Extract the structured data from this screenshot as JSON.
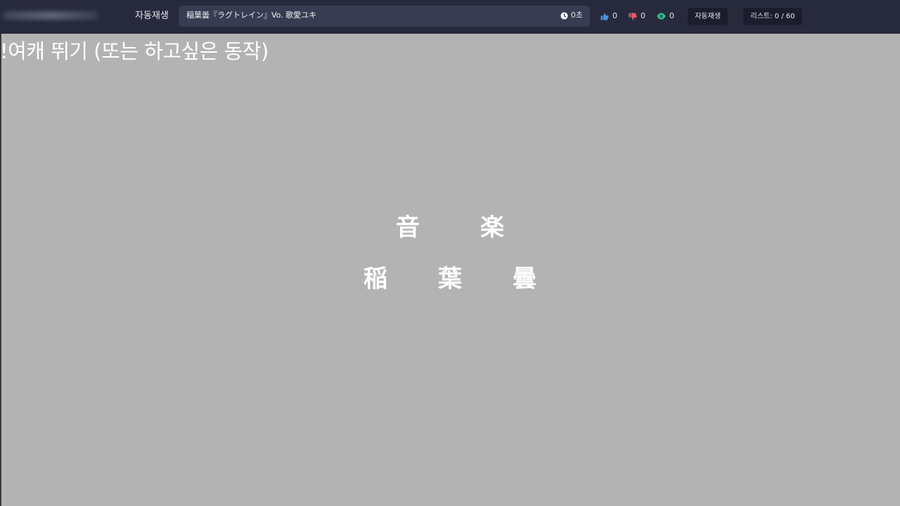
{
  "header": {
    "autoplay_label": "자동재생",
    "song": {
      "title": "稲葉曇『ラグトレイン』Vo. 歌愛ユキ",
      "duration": "0초"
    },
    "stats": {
      "likes": "0",
      "dislikes": "0",
      "views": "0"
    },
    "autoplay_button": "자동재생",
    "list_button": "리스트: 0 / 60"
  },
  "video": {
    "overlay_text": "!여캐 뛰기 (또는 하고싶은 동작)",
    "line1": "音楽",
    "line2": "稲葉曇"
  },
  "icons": {
    "clock": "clock-icon",
    "like": "thumbs-up-icon",
    "dislike": "thumbs-down-icon",
    "views": "eye-icon"
  },
  "colors": {
    "topbar": "#272a3c",
    "like": "#4a90e2",
    "dislike": "#e05a66",
    "views": "#2ecc87",
    "video_background": "#b3b3b3"
  }
}
